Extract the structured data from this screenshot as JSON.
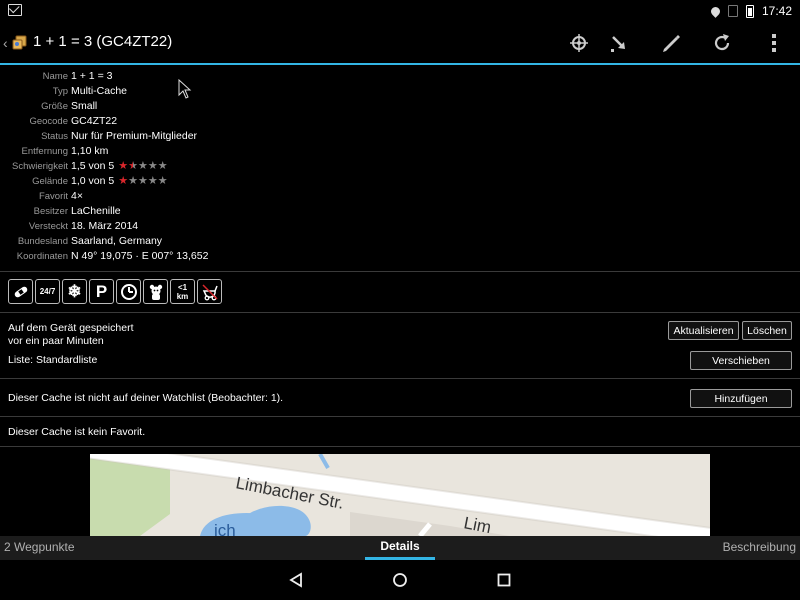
{
  "status_bar": {
    "time": "17:42"
  },
  "header": {
    "title": "1 + 1 = 3 (GC4ZT22)"
  },
  "details": [
    {
      "label": "Name",
      "value": "1 + 1 = 3"
    },
    {
      "label": "Typ",
      "value": "Multi-Cache"
    },
    {
      "label": "Größe",
      "value": "Small"
    },
    {
      "label": "Geocode",
      "value": "GC4ZT22"
    },
    {
      "label": "Status",
      "value": "Nur für Premium-Mitglieder"
    },
    {
      "label": "Entfernung",
      "value": "1,10 km"
    },
    {
      "label": "Schwierigkeit",
      "value": "1,5 von 5",
      "rating": 1.5
    },
    {
      "label": "Gelände",
      "value": "1,0 von 5",
      "rating": 1.0
    },
    {
      "label": "Favorit",
      "value": "4×"
    },
    {
      "label": "Besitzer",
      "value": "LaChenille"
    },
    {
      "label": "Versteckt",
      "value": "18. März 2014"
    },
    {
      "label": "Bundesland",
      "value": "Saarland, Germany"
    },
    {
      "label": "Koordinaten",
      "value": "N 49° 19,075 · E 007° 13,652"
    }
  ],
  "attributes": [
    {
      "icon": "bandage-icon",
      "text": ""
    },
    {
      "icon": "available-24-7-icon",
      "text": "24/7"
    },
    {
      "icon": "winter-snowflake-icon",
      "text": ""
    },
    {
      "icon": "parking-icon",
      "text": "P"
    },
    {
      "icon": "time-clock-icon",
      "text": ""
    },
    {
      "icon": "kid-friendly-icon",
      "text": ""
    },
    {
      "icon": "short-hike-icon",
      "text": "<1 km"
    },
    {
      "icon": "stroller-icon",
      "text": ""
    }
  ],
  "storage": {
    "line1": "Auf dem Gerät gespeichert",
    "line2": "vor ein paar Minuten",
    "list": "Liste: Standardliste",
    "refresh_label": "Aktualisieren",
    "delete_label": "Löschen",
    "move_label": "Verschieben"
  },
  "watchlist": {
    "text": "Dieser Cache ist nicht auf deiner Watchlist (Beobachter: 1).",
    "add_label": "Hinzufügen"
  },
  "favorite": {
    "text": "Dieser Cache ist kein Favorit."
  },
  "map": {
    "street1": "Limbacher Str.",
    "street2": "Lim",
    "partial": "ich"
  },
  "tabs": {
    "left": "2 Wegpunkte",
    "center": "Details",
    "right": "Beschreibung"
  },
  "colors": {
    "accent": "#33b5e5",
    "star_on": "#d9262b",
    "star_off": "#888888"
  }
}
